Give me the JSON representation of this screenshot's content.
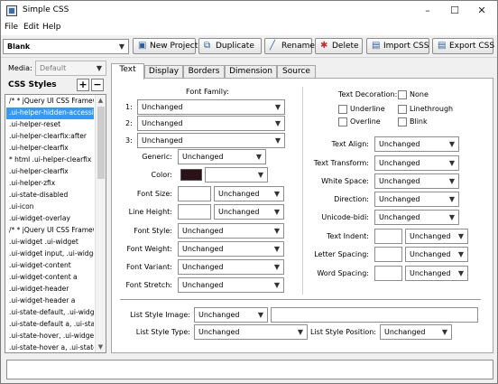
{
  "window": {
    "title": "Simple CSS",
    "minimize_icon": "minimize-icon",
    "maximize_icon": "maximize-icon",
    "close_icon": "close-icon"
  },
  "menu": [
    "File",
    "Edit",
    "Help"
  ],
  "toolbar": {
    "stylesheet": "Blank",
    "buttons": [
      {
        "label": "New Project",
        "icon": "new-project-icon",
        "glyph": "▣"
      },
      {
        "label": "Duplicate",
        "icon": "duplicate-icon",
        "glyph": "⧉"
      },
      {
        "label": "Rename",
        "icon": "rename-icon",
        "glyph": "╱"
      },
      {
        "label": "Delete",
        "icon": "delete-icon",
        "glyph": "✱"
      },
      {
        "label": "Import CSS",
        "icon": "import-icon",
        "glyph": "▤"
      },
      {
        "label": "Export CSS",
        "icon": "export-icon",
        "glyph": "▤"
      }
    ]
  },
  "left": {
    "media_label": "Media:",
    "media_value": "Default",
    "styles_title": "CSS Styles",
    "add_button": "+",
    "remove_button": "−",
    "items": [
      "/* * jQuery UI CSS Framew",
      ".ui-helper-hidden-accessib",
      ".ui-helper-reset",
      ".ui-helper-clearfix:after",
      ".ui-helper-clearfix",
      "* html .ui-helper-clearfix",
      ".ui-helper-clearfix",
      ".ui-helper-zfix",
      ".ui-state-disabled",
      ".ui-icon",
      ".ui-widget-overlay",
      "/* * jQuery UI CSS Framew",
      ".ui-widget .ui-widget",
      ".ui-widget input, .ui-widget",
      ".ui-widget-content",
      ".ui-widget-content a",
      ".ui-widget-header",
      ".ui-widget-header a",
      ".ui-state-default, .ui-widge",
      ".ui-state-default a, .ui-stat",
      ".ui-state-hover, .ui-widget",
      ".ui-state-hover a, .ui-state"
    ],
    "selected_index": 1
  },
  "tabs": [
    "Text",
    "Display",
    "Borders",
    "Dimension",
    "Source"
  ],
  "text_tab": {
    "font_family_title": "Font Family:",
    "font_rows": [
      "1:",
      "2:",
      "3:"
    ],
    "unchanged": "Unchanged",
    "generic_label": "Generic:",
    "color_label": "Color:",
    "color_swatch": "#2a1218",
    "font_size_label": "Font Size:",
    "line_height_label": "Line Height:",
    "font_style_label": "Font Style:",
    "font_weight_label": "Font Weight:",
    "font_variant_label": "Font Variant:",
    "font_stretch_label": "Font Stretch:",
    "text_decoration_label": "Text Decoration:",
    "decorations": [
      "None",
      "Underline",
      "Linethrough",
      "Overline",
      "Blink"
    ],
    "text_align_label": "Text Align:",
    "text_transform_label": "Text Transform:",
    "white_space_label": "White Space:",
    "direction_label": "Direction:",
    "unicode_bidi_label": "Unicode-bidi:",
    "text_indent_label": "Text Indent:",
    "letter_spacing_label": "Letter Spacing:",
    "word_spacing_label": "Word Spacing:",
    "list_style_image_label": "List Style Image:",
    "list_style_type_label": "List Style Type:",
    "list_style_position_label": "List Style Position:"
  }
}
